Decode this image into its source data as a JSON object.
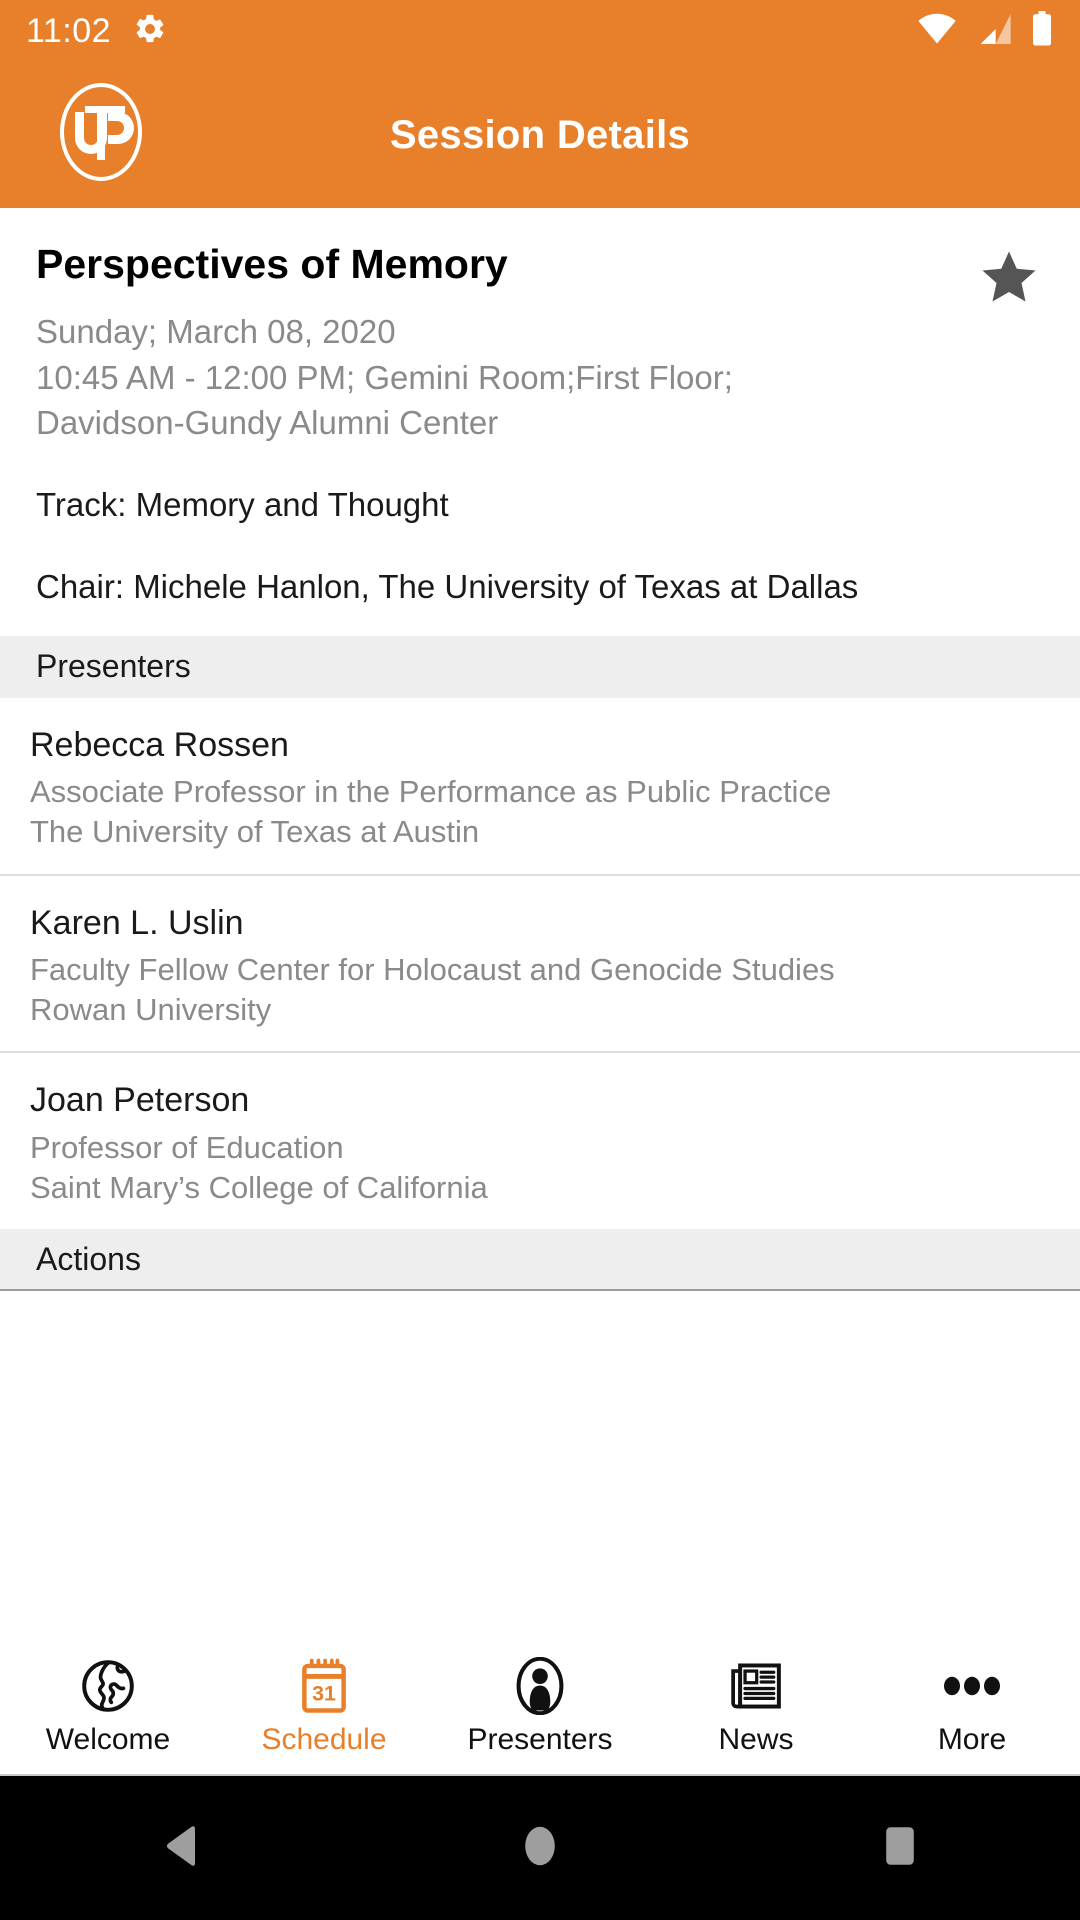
{
  "status_bar": {
    "time": "11:02",
    "icons": [
      "gear-icon",
      "wifi-icon",
      "cellular-signal-icon",
      "battery-icon"
    ]
  },
  "app_bar": {
    "logo": "utd-logo",
    "logo_text": "UTD",
    "title": "Session Details"
  },
  "session": {
    "title": "Perspectives of Memory",
    "favorite_icon": "star-icon",
    "favorite_active": true,
    "date": "Sunday; March 08, 2020",
    "time_location_line1": "10:45 AM - 12:00 PM; Gemini Room;First Floor;",
    "time_location_line2": "Davidson-Gundy Alumni Center",
    "track": "Track: Memory and Thought",
    "chair": "Chair: Michele Hanlon, The University of Texas at Dallas"
  },
  "sections": {
    "presenters_header": "Presenters",
    "actions_header": "Actions"
  },
  "presenters": [
    {
      "name": "Rebecca  Rossen",
      "role": "Associate Professor in the Performance as Public Practice",
      "org": "The University of Texas at Austin"
    },
    {
      "name": "Karen L. Uslin",
      "role": "Faculty Fellow Center for Holocaust and Genocide Studies",
      "org": "Rowan University"
    },
    {
      "name": "Joan  Peterson",
      "role": "Professor of Education",
      "org": "Saint Mary’s College of California"
    }
  ],
  "tab_bar": {
    "active_index": 1,
    "tabs": [
      {
        "label": "Welcome",
        "icon": "globe-icon"
      },
      {
        "label": "Schedule",
        "icon": "calendar-icon",
        "badge": "31"
      },
      {
        "label": "Presenters",
        "icon": "person-icon"
      },
      {
        "label": "News",
        "icon": "newspaper-icon"
      },
      {
        "label": "More",
        "icon": "ellipsis-icon"
      }
    ]
  },
  "nav_bar": {
    "buttons": [
      {
        "name": "back-button",
        "icon": "triangle-back-icon"
      },
      {
        "name": "home-button",
        "icon": "circle-home-icon"
      },
      {
        "name": "recents-button",
        "icon": "square-recents-icon"
      }
    ]
  },
  "colors": {
    "brand_orange": "#E8802B",
    "band_gray": "#EEEEEE",
    "muted_text": "#8A8A8A",
    "star_gray": "#555555"
  }
}
